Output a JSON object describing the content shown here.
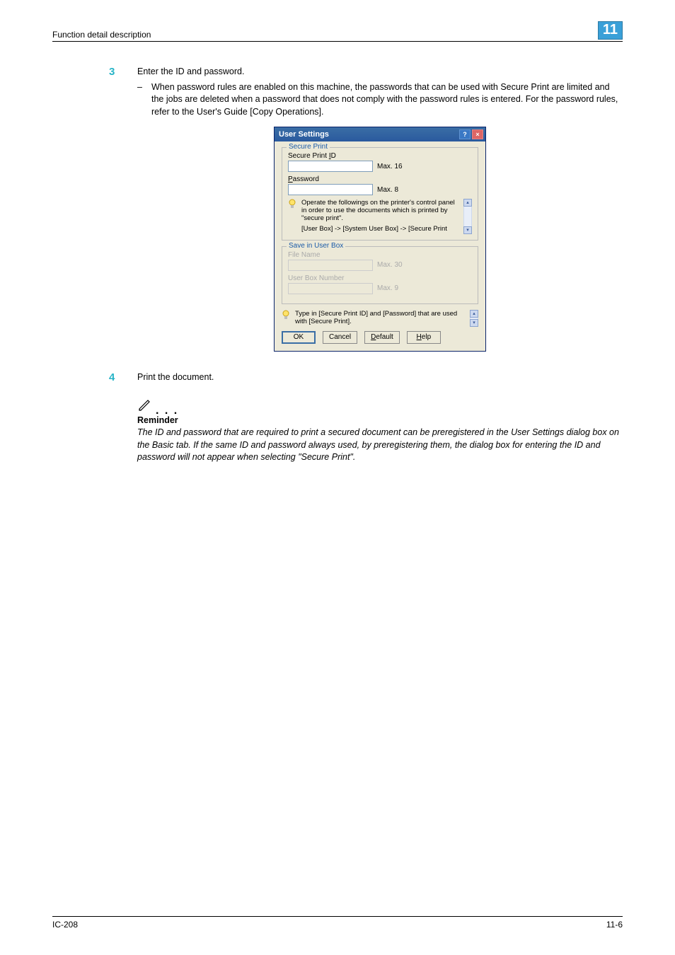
{
  "header": {
    "left": "Function detail description",
    "chapter": "11"
  },
  "steps": {
    "s3": {
      "num": "3",
      "text": "Enter the ID and password.",
      "bullet": "When password rules are enabled on this machine, the passwords that can be used with Secure Print are limited and the jobs are deleted when a password that does not comply with the password rules is entered. For the password rules, refer to the User's Guide [Copy Operations]."
    },
    "s4": {
      "num": "4",
      "text": "Print the document."
    }
  },
  "dialog": {
    "title": "User Settings",
    "secure": {
      "legend": "Secure Print",
      "id_label": "Secure Print ID",
      "id_max": "Max. 16",
      "pwd_label": "Password",
      "pwd_max": "Max. 8",
      "tip1": "Operate the followings on the printer's control panel in order to use the documents which is printed by \"secure print\".",
      "tip2": "[User Box] -> [System User Box] -> [Secure Print"
    },
    "save": {
      "legend": "Save in User Box",
      "file_label": "File Name",
      "file_max": "Max. 30",
      "box_label": "User Box Number",
      "box_max": "Max. 9"
    },
    "lower_tip": "Type in [Secure Print ID] and [Password] that are used with [Secure Print].",
    "buttons": {
      "ok": "OK",
      "cancel": "Cancel",
      "default_pre": "",
      "default_u": "D",
      "default_post": "efault",
      "help_pre": "",
      "help_u": "H",
      "help_post": "elp"
    }
  },
  "note": {
    "dots": ". . .",
    "heading": "Reminder",
    "body": "The ID and password that are required to print a secured document can be preregistered in the User Settings dialog box on the Basic tab. If the same ID and password always used, by preregistering them, the dialog box for entering the ID and password will not appear when selecting \"Secure Print\"."
  },
  "footer": {
    "left": "IC-208",
    "right": "11-6"
  }
}
